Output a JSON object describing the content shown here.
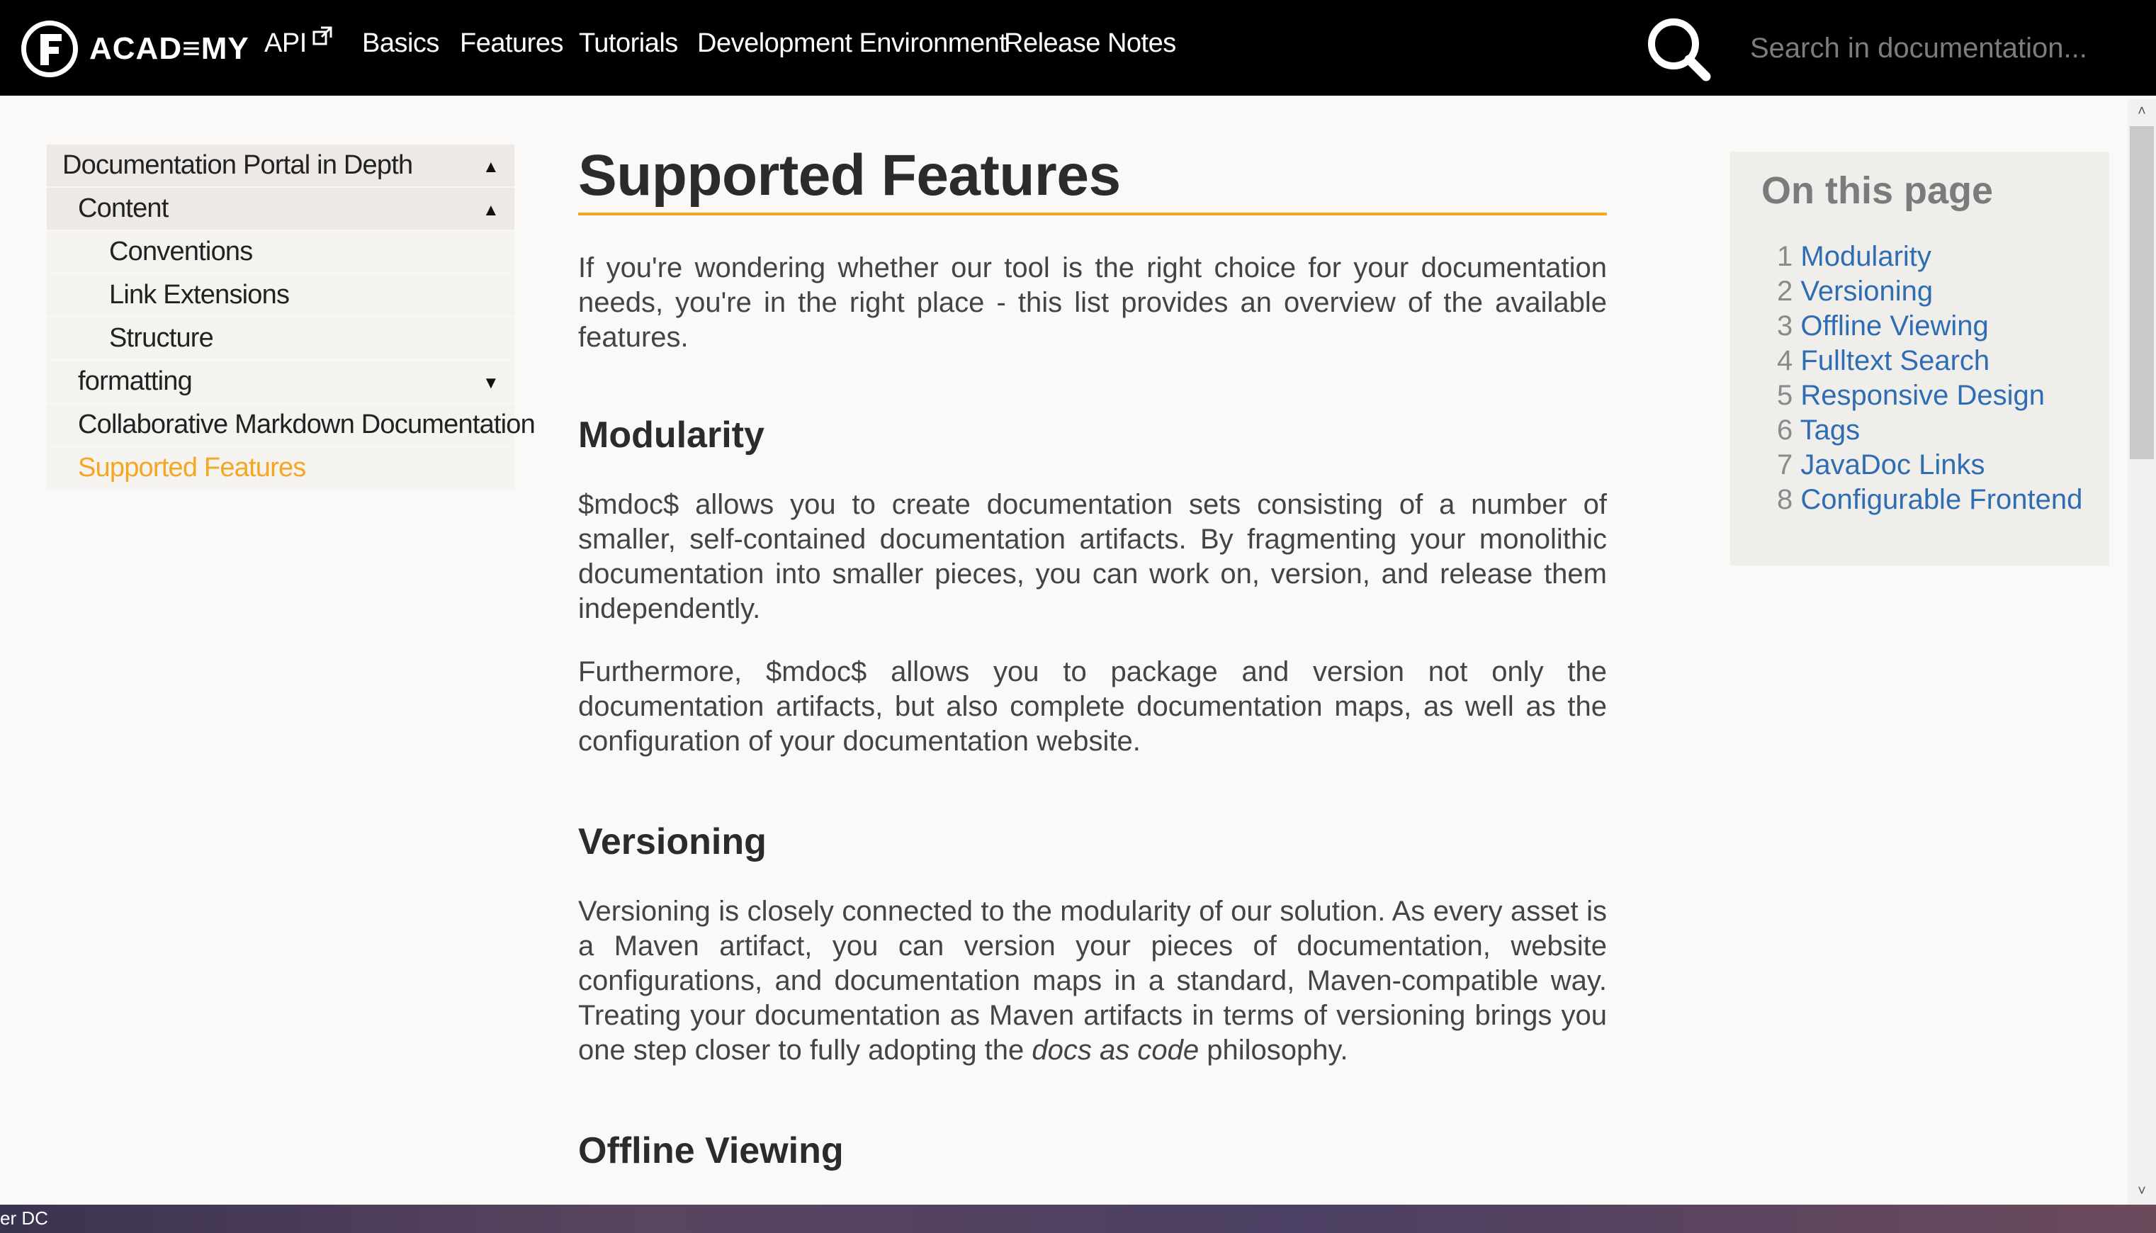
{
  "header": {
    "logo_text": "ACAD≡MY",
    "nav": [
      {
        "label": "API",
        "external": true
      },
      {
        "label": "Basics"
      },
      {
        "label": "Features"
      },
      {
        "label": "Tutorials"
      },
      {
        "label": "Development Environment"
      },
      {
        "label": "Release Notes"
      }
    ],
    "search_placeholder": "Search in documentation..."
  },
  "sidebar": {
    "items": [
      {
        "label": "Documentation Portal in Depth",
        "level": 0,
        "expanded": true
      },
      {
        "label": "Content",
        "level": 1,
        "expanded": true
      },
      {
        "label": "Conventions",
        "level": 2
      },
      {
        "label": "Link Extensions",
        "level": 2
      },
      {
        "label": "Structure",
        "level": 2
      },
      {
        "label": "formatting",
        "level": 1,
        "expanded": false
      },
      {
        "label": "Collaborative Markdown Documentation",
        "level": 1
      },
      {
        "label": "Supported Features",
        "level": 1,
        "active": true
      }
    ]
  },
  "main": {
    "title": "Supported Features",
    "intro": "If you're wondering whether our tool is the right choice for your documentation needs, you're in the right place - this list provides an overview of the available features.",
    "sections": [
      {
        "heading": "Modularity",
        "paragraphs": [
          "$mdoc$ allows you to create documentation sets consisting of a number of smaller, self-contained documentation artifacts. By fragmenting your monolithic documentation into smaller pieces, you can work on, version, and release them independently.",
          "Furthermore, $mdoc$ allows you to package and version not only the documentation artifacts, but also complete documentation maps, as well as the configuration of your documentation website."
        ]
      },
      {
        "heading": "Versioning",
        "paragraphs": [
          "Versioning is closely connected to the modularity of our solution. As every asset is a Maven artifact, you can version your pieces of documentation, website configurations, and documentation maps in a standard, Maven-compatible way. Treating your documentation as Maven artifacts in terms of versioning brings you one step closer to fully adopting the ",
          "docs as code",
          " philosophy."
        ]
      },
      {
        "heading": "Offline Viewing"
      }
    ]
  },
  "toc": {
    "title": "On this page",
    "items": [
      {
        "num": "1",
        "label": "Modularity"
      },
      {
        "num": "2",
        "label": "Versioning"
      },
      {
        "num": "3",
        "label": "Offline Viewing"
      },
      {
        "num": "4",
        "label": "Fulltext Search"
      },
      {
        "num": "5",
        "label": "Responsive Design"
      },
      {
        "num": "6",
        "label": "Tags"
      },
      {
        "num": "7",
        "label": "JavaDoc Links"
      },
      {
        "num": "8",
        "label": "Configurable Frontend"
      }
    ]
  },
  "taskbar": {
    "label": "er DC"
  },
  "colors": {
    "accent": "#f5a623",
    "link": "#2f6db3",
    "header_bg": "#000000",
    "page_bg": "#fbf9f7"
  }
}
